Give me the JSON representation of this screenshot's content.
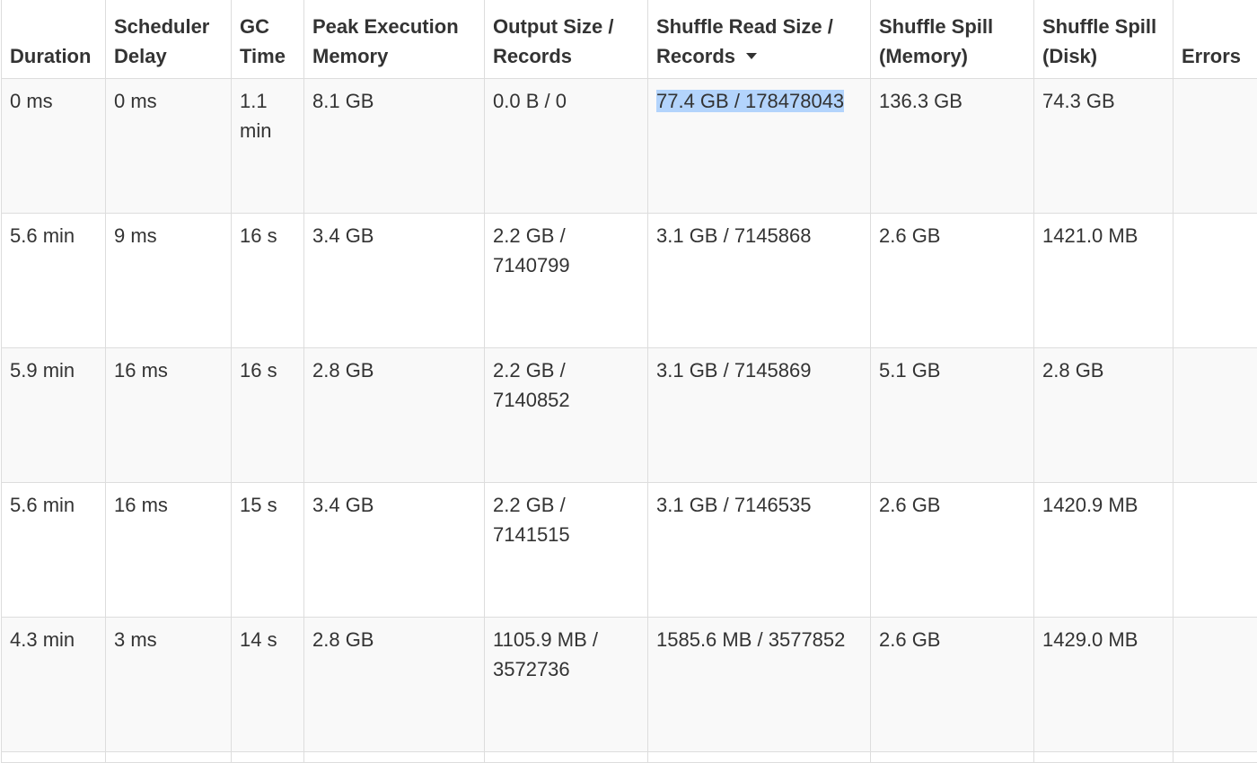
{
  "table": {
    "columns": [
      {
        "line1": "Duration",
        "line2": ""
      },
      {
        "line1": "Scheduler",
        "line2": "Delay"
      },
      {
        "line1": "GC",
        "line2": "Time"
      },
      {
        "line1": "Peak Execution",
        "line2": "Memory"
      },
      {
        "line1": "Output Size /",
        "line2": "Records"
      },
      {
        "line1": "Shuffle Read Size /",
        "line2": "Records"
      },
      {
        "line1": "Shuffle Spill",
        "line2": "(Memory)"
      },
      {
        "line1": "Shuffle Spill",
        "line2": "(Disk)"
      },
      {
        "line1": "Errors",
        "line2": ""
      }
    ],
    "sorted_column": "Shuffle Read Size / Records",
    "sort_direction": "descending",
    "sort_icon": "caret-down-icon",
    "selected_text_color": "#b3d4fc",
    "rows": [
      [
        "0 ms",
        "0 ms",
        "1.1 min",
        "8.1 GB",
        "0.0 B / 0",
        "77.4 GB / 178478043",
        "136.3 GB",
        "74.3 GB",
        ""
      ],
      [
        "5.6 min",
        "9 ms",
        "16 s",
        "3.4 GB",
        "2.2 GB / 7140799",
        "3.1 GB / 7145868",
        "2.6 GB",
        "1421.0 MB",
        ""
      ],
      [
        "5.9 min",
        "16 ms",
        "16 s",
        "2.8 GB",
        "2.2 GB / 7140852",
        "3.1 GB / 7145869",
        "5.1 GB",
        "2.8 GB",
        ""
      ],
      [
        "5.6 min",
        "16 ms",
        "15 s",
        "3.4 GB",
        "2.2 GB / 7141515",
        "3.1 GB / 7146535",
        "2.6 GB",
        "1420.9 MB",
        ""
      ],
      [
        "4.3 min",
        "3 ms",
        "14 s",
        "2.8 GB",
        "1105.9 MB / 3572736",
        "1585.6 MB / 3577852",
        "2.6 GB",
        "1429.0 MB",
        ""
      ]
    ]
  }
}
